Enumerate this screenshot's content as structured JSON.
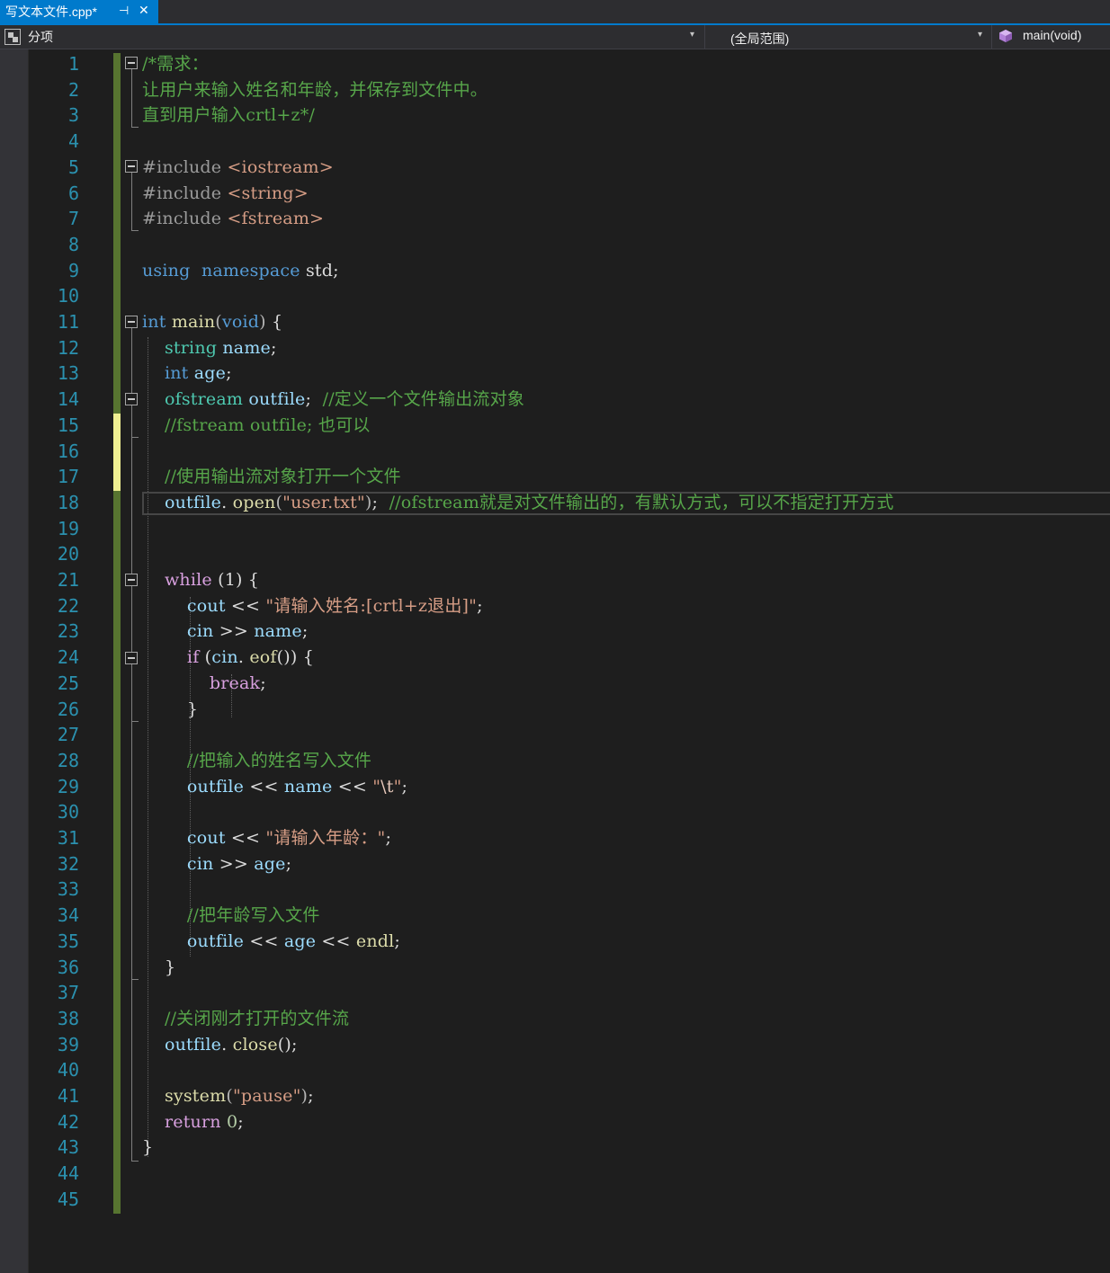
{
  "tab": {
    "title": "写文本文件.cpp*",
    "pin_icon": "pin-icon",
    "close_icon": "close-icon"
  },
  "navbar": {
    "project": "分项",
    "scope": "(全局范围)",
    "member": "main(void)"
  },
  "colors": {
    "accent": "#007acc",
    "background": "#1e1e1e",
    "line_number": "#2b91af",
    "keyword": "#569cd6",
    "control_keyword": "#d8a0df",
    "type": "#4ec9b0",
    "function": "#dcdcaa",
    "variable": "#9cdcfe",
    "string": "#d69d85",
    "comment": "#57a64a",
    "saved_change": "#577430",
    "unsaved_change": "#efef91"
  },
  "editor": {
    "lines": [
      [
        [
          "cm",
          "/*需求："
        ]
      ],
      [
        [
          "cm",
          "让用户来输入姓名和年龄，并保存到文件中。"
        ]
      ],
      [
        [
          "cm",
          "直到用户输入crtl+z*/"
        ]
      ],
      [],
      [
        [
          "pp",
          "#include "
        ],
        [
          "inc",
          "<iostream>"
        ]
      ],
      [
        [
          "pp",
          "#include "
        ],
        [
          "inc",
          "<string>"
        ]
      ],
      [
        [
          "pp",
          "#include "
        ],
        [
          "inc",
          "<fstream>"
        ]
      ],
      [],
      [
        [
          "kw",
          "using"
        ],
        [
          "",
          "  "
        ],
        [
          "kw",
          "namespace"
        ],
        [
          "",
          " std;"
        ]
      ],
      [],
      [
        [
          "kw",
          "int"
        ],
        [
          "",
          " "
        ],
        [
          "fn",
          "main"
        ],
        [
          "op",
          "("
        ],
        [
          "kw",
          "void"
        ],
        [
          "op",
          ")"
        ],
        [
          "",
          " {"
        ]
      ],
      [
        [
          "",
          "    "
        ],
        [
          "ty",
          "string"
        ],
        [
          "",
          " "
        ],
        [
          "var",
          "name"
        ],
        [
          "",
          ";"
        ]
      ],
      [
        [
          "",
          "    "
        ],
        [
          "kw",
          "int"
        ],
        [
          "",
          " "
        ],
        [
          "var",
          "age"
        ],
        [
          "",
          ";"
        ]
      ],
      [
        [
          "",
          "    "
        ],
        [
          "ty",
          "ofstream"
        ],
        [
          "",
          " "
        ],
        [
          "var",
          "outfile"
        ],
        [
          "",
          ";  "
        ],
        [
          "cm",
          "//定义一个文件输出流对象"
        ]
      ],
      [
        [
          "",
          "    "
        ],
        [
          "cm",
          "//fstream outfile; 也可以"
        ]
      ],
      [],
      [
        [
          "",
          "    "
        ],
        [
          "cm",
          "//使用输出流对象打开一个文件"
        ]
      ],
      [
        [
          "",
          "    "
        ],
        [
          "var",
          "outfile"
        ],
        [
          "",
          ". "
        ],
        [
          "fn",
          "open"
        ],
        [
          "op",
          "("
        ],
        [
          "str",
          "\"user.txt\""
        ],
        [
          "op",
          ")"
        ],
        [
          "",
          ";  "
        ],
        [
          "cm",
          "//ofstream就是对文件输出的，有默认方式，可以不指定打开方式"
        ]
      ],
      [],
      [],
      [
        [
          "",
          "    "
        ],
        [
          "kwc",
          "while"
        ],
        [
          "",
          " (1) {"
        ]
      ],
      [
        [
          "",
          "        "
        ],
        [
          "var",
          "cout"
        ],
        [
          "",
          " << "
        ],
        [
          "str",
          "\"请输入姓名:[crtl+z退出]\""
        ],
        [
          "",
          ";"
        ]
      ],
      [
        [
          "",
          "        "
        ],
        [
          "var",
          "cin"
        ],
        [
          "",
          " >> "
        ],
        [
          "var",
          "name"
        ],
        [
          "",
          ";"
        ]
      ],
      [
        [
          "",
          "        "
        ],
        [
          "kwc",
          "if"
        ],
        [
          "",
          " ("
        ],
        [
          "var",
          "cin"
        ],
        [
          "",
          ". "
        ],
        [
          "fn",
          "eof"
        ],
        [
          "",
          "()) {"
        ]
      ],
      [
        [
          "",
          "            "
        ],
        [
          "kwc",
          "break"
        ],
        [
          "",
          ";"
        ]
      ],
      [
        [
          "",
          "        }"
        ]
      ],
      [],
      [
        [
          "",
          "        "
        ],
        [
          "cm",
          "//把输入的姓名写入文件"
        ]
      ],
      [
        [
          "",
          "        "
        ],
        [
          "var",
          "outfile"
        ],
        [
          "",
          " << "
        ],
        [
          "var",
          "name"
        ],
        [
          "",
          " << "
        ],
        [
          "str",
          "\""
        ],
        [
          "esc",
          "\\t"
        ],
        [
          "str",
          "\""
        ],
        [
          "",
          ";"
        ]
      ],
      [],
      [
        [
          "",
          "        "
        ],
        [
          "var",
          "cout"
        ],
        [
          "",
          " << "
        ],
        [
          "str",
          "\"请输入年龄：\""
        ],
        [
          "",
          ";"
        ]
      ],
      [
        [
          "",
          "        "
        ],
        [
          "var",
          "cin"
        ],
        [
          "",
          " >> "
        ],
        [
          "var",
          "age"
        ],
        [
          "",
          ";"
        ]
      ],
      [],
      [
        [
          "",
          "        "
        ],
        [
          "cm",
          "//把年龄写入文件"
        ]
      ],
      [
        [
          "",
          "        "
        ],
        [
          "var",
          "outfile"
        ],
        [
          "",
          " << "
        ],
        [
          "var",
          "age"
        ],
        [
          "",
          " << "
        ],
        [
          "fn",
          "endl"
        ],
        [
          "",
          ";"
        ]
      ],
      [
        [
          "",
          "    }"
        ]
      ],
      [],
      [
        [
          "",
          "    "
        ],
        [
          "cm",
          "//关闭刚才打开的文件流"
        ]
      ],
      [
        [
          "",
          "    "
        ],
        [
          "var",
          "outfile"
        ],
        [
          "",
          ". "
        ],
        [
          "fn",
          "close"
        ],
        [
          "",
          "();"
        ]
      ],
      [],
      [
        [
          "",
          "    "
        ],
        [
          "fn",
          "system"
        ],
        [
          "op",
          "("
        ],
        [
          "str",
          "\"pause\""
        ],
        [
          "op",
          ")"
        ],
        [
          "",
          ";"
        ]
      ],
      [
        [
          "",
          "    "
        ],
        [
          "kwc",
          "return"
        ],
        [
          "",
          " "
        ],
        [
          "num",
          "0"
        ],
        [
          "",
          ";"
        ]
      ],
      [
        [
          "",
          "}"
        ]
      ],
      [],
      []
    ]
  }
}
